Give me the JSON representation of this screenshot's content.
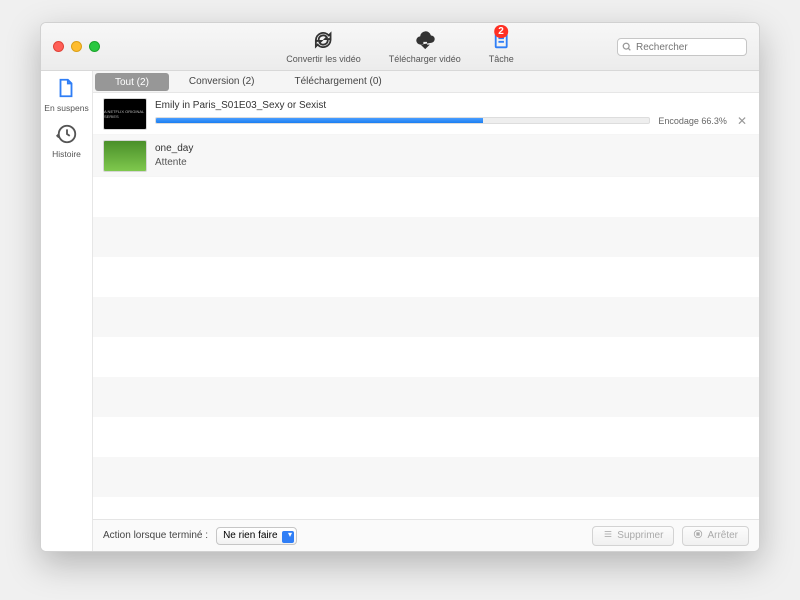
{
  "toolbar": {
    "convert_label": "Convertir les vidéo",
    "download_label": "Télécharger vidéo",
    "task_label": "Tâche",
    "task_badge": "2",
    "search_placeholder": "Rechercher"
  },
  "sidebar": {
    "pending_label": "En suspens",
    "history_label": "Histoire"
  },
  "tabs": {
    "all": "Tout (2)",
    "conversion": "Conversion (2)",
    "download": "Téléchargement (0)"
  },
  "items": [
    {
      "title": "Emily in Paris_S01E03_Sexy or Sexist",
      "status_text": "Encodage 66.3%",
      "progress_pct": 66.3,
      "has_progress": true,
      "thumb_kind": "dark"
    },
    {
      "title": "one_day",
      "status_text": "Attente",
      "has_progress": false,
      "thumb_kind": "green"
    }
  ],
  "footer": {
    "action_label": "Action lorsque terminé :",
    "action_value": "Ne rien faire",
    "delete_label": "Supprimer",
    "stop_label": "Arrêter"
  }
}
